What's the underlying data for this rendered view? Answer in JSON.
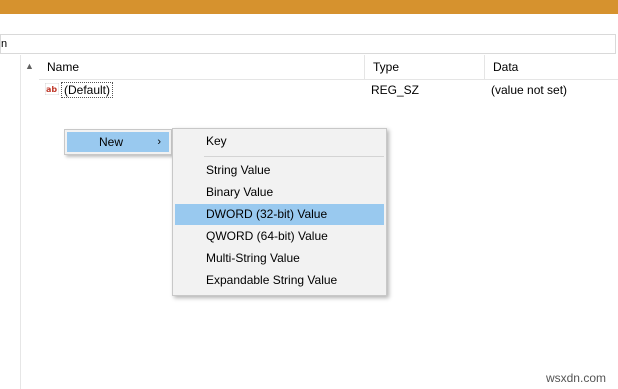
{
  "window": {
    "address_fragment": "n"
  },
  "listview": {
    "columns": {
      "name": "Name",
      "type": "Type",
      "data": "Data"
    },
    "rows": [
      {
        "name": "(Default)",
        "type": "REG_SZ",
        "data": "(value not set)",
        "icon": "string-value-icon"
      }
    ]
  },
  "context_menu": {
    "item": {
      "label": "New",
      "chevron": "›"
    }
  },
  "submenu": {
    "items": [
      {
        "label": "Key"
      },
      {
        "label": "String Value"
      },
      {
        "label": "Binary Value"
      },
      {
        "label": "DWORD (32-bit) Value",
        "highlighted": true
      },
      {
        "label": "QWORD (64-bit) Value"
      },
      {
        "label": "Multi-String Value"
      },
      {
        "label": "Expandable String Value"
      }
    ]
  },
  "watermark": "wsxdn.com",
  "colors": {
    "titlebar": "#d6922e",
    "highlight": "#99c9ef",
    "menu_bg": "#f2f2f2"
  }
}
